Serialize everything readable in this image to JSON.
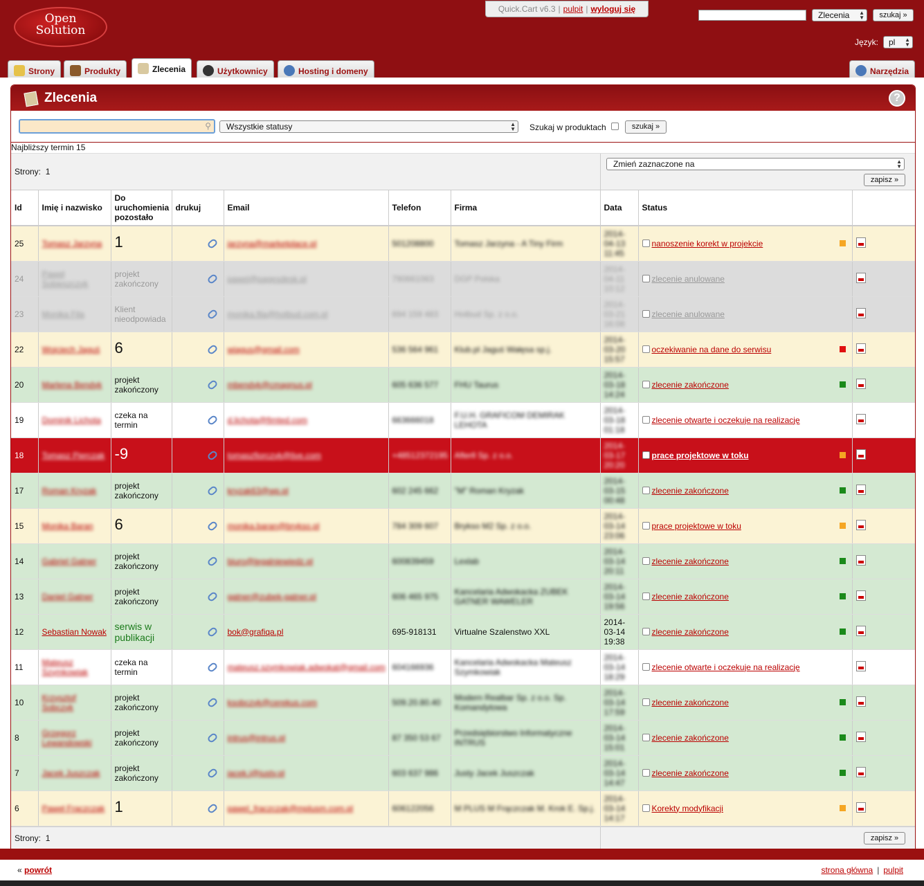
{
  "header": {
    "logo": [
      "Open",
      "Solution"
    ],
    "app_version": "Quick.Cart v6.3",
    "link_dashboard": "pulpit",
    "link_logout": "wyloguj się",
    "search_value": "",
    "search_scope": "Zlecenia",
    "search_button": "szukaj »",
    "language_label": "Język:",
    "language_value": "pl"
  },
  "tabs": [
    {
      "label": "Strony",
      "icon": "pencil-icon",
      "active": false
    },
    {
      "label": "Produkty",
      "icon": "box-icon",
      "active": false
    },
    {
      "label": "Zlecenia",
      "icon": "orders-icon",
      "active": true
    },
    {
      "label": "Użytkownicy",
      "icon": "user-icon",
      "active": false
    },
    {
      "label": "Hosting i domeny",
      "icon": "gears-icon",
      "active": false
    },
    {
      "label": "Narzędzia",
      "icon": "gears-icon",
      "active": false
    }
  ],
  "panel": {
    "title": "Zlecenia",
    "help": "?"
  },
  "filters": {
    "search_value": "",
    "status_select": "Wszystkie statusy",
    "search_in_products_label": "Szukaj w produktach",
    "search_button": "szukaj »"
  },
  "nearest_deadline": "Najbliższy termin 15",
  "pager": {
    "label": "Strony:",
    "value": "1"
  },
  "bulk": {
    "select": "Zmień zaznaczone na",
    "save_button": "zapisz »"
  },
  "columns": [
    "Id",
    "Imię i nazwisko",
    "Do uruchomienia pozostało",
    "drukuj",
    "Email",
    "Telefon",
    "Firma",
    "Data",
    "Status",
    ""
  ],
  "rows": [
    {
      "id": "25",
      "name": "Tomasz Jarzyna",
      "remaining": "1",
      "remaining_big": true,
      "email": "jarzyna@marketplace.pl",
      "phone": "501208800",
      "company": "Tomasz Jarzyna - A Tiny Firm",
      "date": "2014-04-13 11:45",
      "status": "nanoszenie korekt w projekcie",
      "marker": "#f5a623",
      "row": "yellow",
      "blur": true
    },
    {
      "id": "24",
      "name": "Paweł Sobieszczyk",
      "remaining": "projekt zakończony",
      "remaining_big": false,
      "email": "pawel@pagesdesk.pl",
      "phone": "790661063",
      "company": "DGP Polska",
      "date": "2014-04-11 10:12",
      "status": "zlecenie anulowane",
      "marker": "",
      "row": "gray",
      "blur": true
    },
    {
      "id": "23",
      "name": "Monika Fila",
      "remaining": "Klient nieodpowiada",
      "remaining_big": false,
      "email": "monika.fila@hotbud.com.pl",
      "phone": "694 159 483",
      "company": "Hotbud Sp. z o.o.",
      "date": "2014-03-21 16:08",
      "status": "zlecenie anulowane",
      "marker": "",
      "row": "gray",
      "blur": true
    },
    {
      "id": "22",
      "name": "Wojciech Jaguś",
      "remaining": "6",
      "remaining_big": true,
      "email": "wjagus@gmail.com",
      "phone": "536 564 961",
      "company": "Klub.pl Jaguś Wałęsa sp.j.",
      "date": "2014-03-20 15:57",
      "status": "oczekiwanie na dane do serwisu",
      "marker": "#e01010",
      "row": "yellow",
      "blur": true
    },
    {
      "id": "20",
      "name": "Marlena Bendyk",
      "remaining": "projekt zakończony",
      "remaining_big": false,
      "email": "mbendyk@cmagnus.pl",
      "phone": "605 636 577",
      "company": "FHU Taurus",
      "date": "2014-03-18 14:24",
      "status": "zlecenie zakończone",
      "marker": "#1a8a1a",
      "row": "green",
      "blur": true
    },
    {
      "id": "19",
      "name": "Dominik Lichota",
      "remaining": "czeka na termin",
      "remaining_big": false,
      "email": "d.lichota@fimted.com",
      "phone": "663666018",
      "company": "F.U.H. GRAFICOM DEMIRAK LEHOTA",
      "date": "2014-03-18 01:18",
      "status": "zlecenie otwarte i oczekuje na realizację",
      "marker": "",
      "row": "white",
      "blur": true
    },
    {
      "id": "18",
      "name": "Tomasz Pierczak",
      "remaining": "-9",
      "remaining_big": true,
      "email": "tomaszfiorczyk@live.com",
      "phone": "+48512372195",
      "company": "Afterll Sp. z o.o.",
      "date": "2014-03-17 20:20",
      "status": "prace projektowe w toku",
      "marker": "#f5a623",
      "row": "red",
      "blur": true
    },
    {
      "id": "17",
      "name": "Roman Kryzak",
      "remaining": "projekt zakończony",
      "remaining_big": false,
      "email": "kryzak63@wp.pl",
      "phone": "602 245 662",
      "company": "\"M\" Roman Kryzak",
      "date": "2014-03-15 00:48",
      "status": "zlecenie zakończone",
      "marker": "#1a8a1a",
      "row": "green",
      "blur": true
    },
    {
      "id": "15",
      "name": "Monika Baran",
      "remaining": "6",
      "remaining_big": true,
      "email": "monika.baran@brykso.pl",
      "phone": "784 309 607",
      "company": "Brykso M2 Sp. z o.o.",
      "date": "2014-03-14 23:06",
      "status": "prace projektowe w toku",
      "marker": "#f5a623",
      "row": "yellow",
      "blur": true
    },
    {
      "id": "14",
      "name": "Gabriel Gatner",
      "remaining": "projekt zakończony",
      "remaining_big": false,
      "email": "biuro@legalniewiedz.pl",
      "phone": "600839459",
      "company": "Lexlab",
      "date": "2014-03-14 20:11",
      "status": "zlecenie zakończone",
      "marker": "#1a8a1a",
      "row": "green",
      "blur": true
    },
    {
      "id": "13",
      "name": "Daniel Gatner",
      "remaining": "projekt zakończony",
      "remaining_big": false,
      "email": "gatner@zubek-gatner.pl",
      "phone": "606 465 975",
      "company": "Kancelaria Adwokacka ZUBEK GATNER WAWELER",
      "date": "2014-03-14 19:56",
      "status": "zlecenie zakończone",
      "marker": "#1a8a1a",
      "row": "green",
      "blur": true
    },
    {
      "id": "12",
      "name": "Sebastian Nowak",
      "remaining": "serwis w publikacji",
      "remaining_big": false,
      "remaining_green": true,
      "email": "bok@grafiqa.pl",
      "phone": "695-918131",
      "company": "Virtualne Szalenstwo XXL",
      "date": "2014-03-14 19:38",
      "status": "zlecenie zakończone",
      "marker": "#1a8a1a",
      "row": "green",
      "blur": false
    },
    {
      "id": "11",
      "name": "Mateusz Szymkowiak",
      "remaining": "czeka na termin",
      "remaining_big": false,
      "email": "mateusz.szymkowiak.adwokat@gmail.com",
      "phone": "604166936",
      "company": "Kancelaria Adwokacka Mateusz Szymkowiak",
      "date": "2014-03-14 18:29",
      "status": "zlecenie otwarte i oczekuje na realizację",
      "marker": "",
      "row": "white",
      "blur": true
    },
    {
      "id": "10",
      "name": "Krzysztof Sobczyk",
      "remaining": "projekt zakończony",
      "remaining_big": false,
      "email": "ksobczyk@cerekus.com",
      "phone": "509.20.80.40",
      "company": "Modern Realbar Sp. z o.o. Sp. Komandytowa",
      "date": "2014-03-14 17:59",
      "status": "zlecenie zakończone",
      "marker": "#1a8a1a",
      "row": "green",
      "blur": true
    },
    {
      "id": "8",
      "name": "Grzegorz Lewandowski",
      "remaining": "projekt zakończony",
      "remaining_big": false,
      "email": "intrus@intrus.pl",
      "phone": "87 350 53 67",
      "company": "Przedsiębiorstwo Informatyczne INTRUS",
      "date": "2014-03-14 15:01",
      "status": "zlecenie zakończone",
      "marker": "#1a8a1a",
      "row": "green",
      "blur": true
    },
    {
      "id": "7",
      "name": "Jacek Juszczak",
      "remaining": "projekt zakończony",
      "remaining_big": false,
      "email": "jacek.j@justy.pl",
      "phone": "603 637 986",
      "company": "Justy Jacek Juszczak",
      "date": "2014-03-14 14:47",
      "status": "zlecenie zakończone",
      "marker": "#1a8a1a",
      "row": "green",
      "blur": true
    },
    {
      "id": "6",
      "name": "Paweł Frączczak",
      "remaining": "1",
      "remaining_big": true,
      "email": "pawel_fraczczak@mplusm.com.pl",
      "phone": "606122056",
      "company": "M PLUS M Frączczak M. Krok E. Sp.j.",
      "date": "2014-03-14 14:17",
      "status": "Korekty modyfikacji",
      "marker": "#f5a623",
      "row": "yellow",
      "blur": true
    }
  ],
  "footer": {
    "back_prefix": "«",
    "back": "powrót",
    "home": "strona główna",
    "dashboard": "pulpit"
  }
}
